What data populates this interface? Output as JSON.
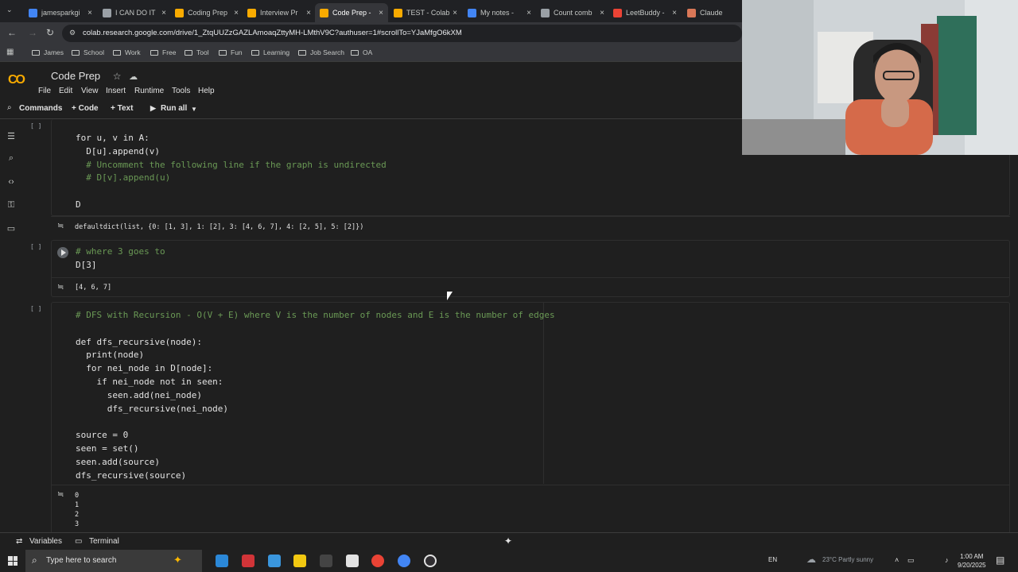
{
  "browser": {
    "tabs": [
      {
        "title": "jamesparkgi",
        "icon_color": "#4285f4"
      },
      {
        "title": "I CAN DO IT",
        "icon_color": "#9aa0a6"
      },
      {
        "title": "Coding Prep",
        "icon_color": "#f9ab00"
      },
      {
        "title": "Interview Pr",
        "icon_color": "#f9ab00"
      },
      {
        "title": "Code Prep -",
        "icon_color": "#f9ab00"
      },
      {
        "title": "TEST - Colab",
        "icon_color": "#f9ab00"
      },
      {
        "title": "My notes - ",
        "icon_color": "#4285f4"
      },
      {
        "title": "Count comb",
        "icon_color": "#9aa0a6"
      },
      {
        "title": "LeetBuddy -",
        "icon_color": "#ea4335"
      },
      {
        "title": "Claude",
        "icon_color": "#d97757"
      }
    ],
    "url": "colab.research.google.com/drive/1_ZtqUUZzGAZLAmoaqZttyMH-LMthV9C?authuser=1#scrollTo=YJaMfgO6kXM",
    "bookmarks": [
      "James",
      "School",
      "Work",
      "Free",
      "Tool",
      "Fun",
      "Learning",
      "Job Search",
      "OA"
    ]
  },
  "colab": {
    "title": "Code Prep",
    "menu": [
      "File",
      "Edit",
      "View",
      "Insert",
      "Runtime",
      "Tools",
      "Help"
    ],
    "toolbar": {
      "commands": "Commands",
      "code": "+ Code",
      "text": "+ Text",
      "run_all": "Run all"
    }
  },
  "cells": {
    "bracket": "[ ]",
    "cell1": {
      "lines": [
        "for u, v in A:",
        "  D[u].append(v)",
        "  # Uncomment the following line if the graph is undirected",
        "  # D[v].append(u)",
        "",
        "D"
      ],
      "output": "defaultdict(list, {0: [1, 3], 1: [2], 3: [4, 6, 7], 4: [2, 5], 5: [2]})"
    },
    "cell2": {
      "lines": [
        "# where 3 goes to",
        "D[3]"
      ],
      "output": "[4, 6, 7]"
    },
    "cell3": {
      "lines": [
        "# DFS with Recursion - O(V + E) where V is the number of nodes and E is the number of edges",
        "",
        "def dfs_recursive(node):",
        "  print(node)",
        "  for nei_node in D[node]:",
        "    if nei_node not in seen:",
        "      seen.add(nei_node)",
        "      dfs_recursive(nei_node)",
        "",
        "source = 0",
        "seen = set()",
        "seen.add(source)",
        "dfs_recursive(source)"
      ],
      "output_lines": [
        "0",
        "1",
        "2",
        "3"
      ]
    }
  },
  "statusbar": {
    "variables": "Variables",
    "terminal": "Terminal"
  },
  "taskbar": {
    "search_placeholder": "Type here to search",
    "language": "EN",
    "weather": "23°C  Partly sunny",
    "time": "1:00 AM",
    "date": "9/20/2025"
  }
}
